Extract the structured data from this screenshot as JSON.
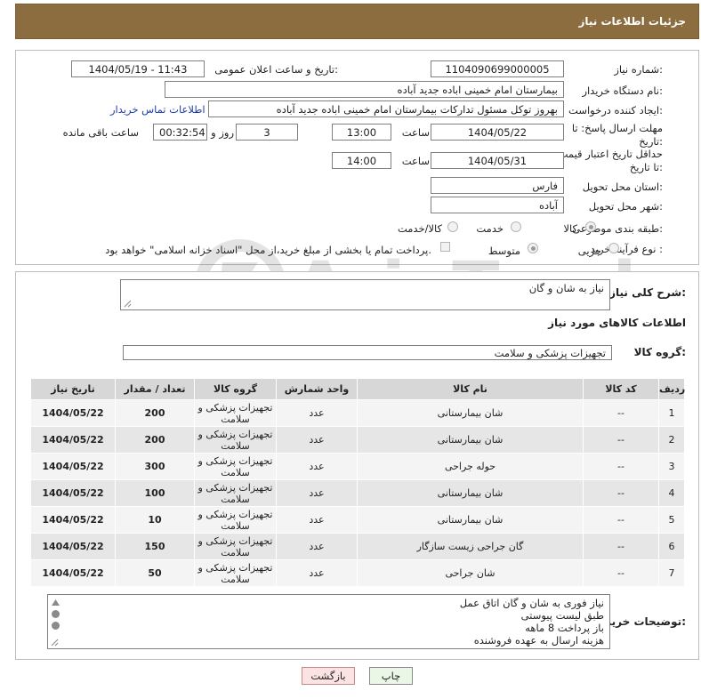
{
  "header": {
    "title": "جزئیات اطلاعات نیاز"
  },
  "form": {
    "need_number_label": "شماره نیاز:",
    "need_number": "1104090699000005",
    "announce_label": "تاریخ و ساعت اعلان عمومی:",
    "announce_value": "1404/05/19 - 11:43",
    "buyer_org_label": "نام دستگاه خریدار:",
    "buyer_org": "بیمارستان امام خمینی اباده جدید آباده",
    "creator_label": "ایجاد کننده درخواست:",
    "creator": "بهروز توکل مسئول تداركات بیمارستان امام خمینی اباده جدید آباده",
    "contact_link": "اطلاعات تماس خریدار",
    "deadline_label": "مهلت ارسال پاسخ: تا تاریخ:",
    "deadline_date": "1404/05/22",
    "time_label": "ساعت",
    "deadline_time": "13:00",
    "days_value": "3",
    "days_label": "روز و",
    "remaining_time": "00:32:54",
    "remaining_label": "ساعت باقی مانده",
    "validity_label": "حداقل تاریخ اعتبار قیمت: تا تاریخ:",
    "validity_date": "1404/05/31",
    "validity_time_label": "ساعت",
    "validity_time": "14:00",
    "province_label": "استان محل تحویل:",
    "province": "فارس",
    "city_label": "شهر محل تحویل:",
    "city": "آباده",
    "category_label": "طبقه بندی موضوعی:",
    "category_options": [
      "کالا",
      "خدمت",
      "کالا/خدمت"
    ],
    "category_selected": "کالا",
    "process_label": "نوع فرآیند خرید :",
    "process_options": [
      "جزیی",
      "متوسط"
    ],
    "process_selected": "متوسط",
    "payment_note": "پرداخت تمام یا بخشی از مبلغ خرید،از محل \"اسناد خزانه اسلامی\" خواهد بود."
  },
  "summary": {
    "label": "شرح کلی نیاز:",
    "value": "نیاز به شان و گان"
  },
  "goods_section": {
    "title": "اطلاعات کالاهای مورد نیاز",
    "group_label": "گروه کالا:",
    "group_value": "تجهیزات پزشکی و سلامت"
  },
  "table": {
    "columns": [
      "ردیف",
      "کد کالا",
      "نام کالا",
      "واحد شمارش",
      "گروه کالا",
      "تعداد / مقدار",
      "تاریخ نیاز"
    ],
    "rows": [
      [
        "1",
        "--",
        "شان بیمارستانی",
        "عدد",
        "تجهیزات پزشکی و سلامت",
        "200",
        "1404/05/22"
      ],
      [
        "2",
        "--",
        "شان بیمارستانی",
        "عدد",
        "تجهیزات پزشکی و سلامت",
        "200",
        "1404/05/22"
      ],
      [
        "3",
        "--",
        "حوله جراحی",
        "عدد",
        "تجهیزات پزشکی و سلامت",
        "300",
        "1404/05/22"
      ],
      [
        "4",
        "--",
        "شان بیمارستانی",
        "عدد",
        "تجهیزات پزشکی و سلامت",
        "100",
        "1404/05/22"
      ],
      [
        "5",
        "--",
        "شان بیمارستانی",
        "عدد",
        "تجهیزات پزشکی و سلامت",
        "10",
        "1404/05/22"
      ],
      [
        "6",
        "--",
        "گان جراحی زیست سازگار",
        "عدد",
        "تجهیزات پزشکی و سلامت",
        "150",
        "1404/05/22"
      ],
      [
        "7",
        "--",
        "شان جراحی",
        "عدد",
        "تجهیزات پزشکی و سلامت",
        "50",
        "1404/05/22"
      ]
    ]
  },
  "buyer_notes": {
    "label": "توضیحات خریدار:",
    "lines": [
      "نیاز فوری به شان و گان اتاق عمل",
      "طبق لیست پیوستی",
      "باز پرداخت 8 ماهه",
      "هزینه ارسال به عهده فروشنده"
    ]
  },
  "buttons": {
    "print": "چاپ",
    "back": "بازگشت"
  },
  "watermark": {
    "text": "AriaTender.neT"
  },
  "colors": {
    "header_bg": "#8b6d3f",
    "link": "#1f3fa8",
    "print_btn": "#eaf7e6",
    "back_btn": "#fbe3e3"
  }
}
